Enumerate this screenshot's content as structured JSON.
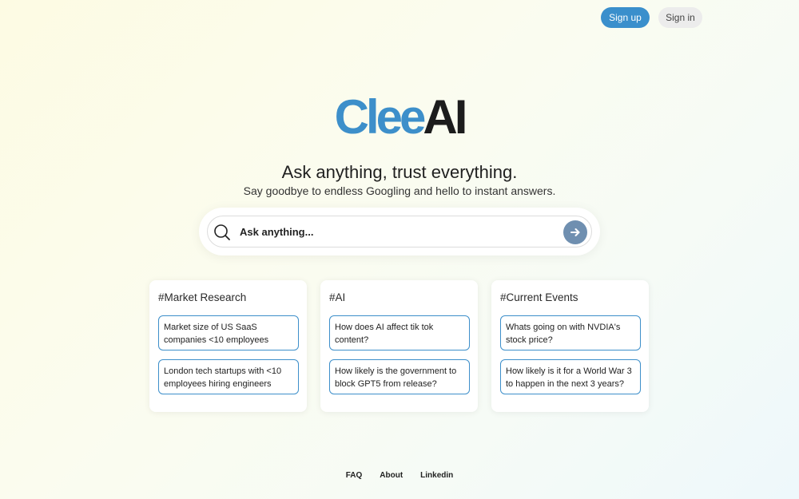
{
  "header": {
    "signup_label": "Sign up",
    "signin_label": "Sign in"
  },
  "logo": {
    "part1": "Clee",
    "part2": "AI"
  },
  "hero": {
    "headline": "Ask anything, trust everything.",
    "subline": "Say goodbye to endless Googling and hello to instant answers."
  },
  "search": {
    "placeholder": "Ask anything...",
    "value": ""
  },
  "cards": [
    {
      "title": "#Market Research",
      "questions": [
        "Market size of US SaaS companies <10 employees",
        "London tech startups with <10 employees hiring engineers"
      ]
    },
    {
      "title": "#AI",
      "questions": [
        "How does AI affect tik tok content?",
        "How likely is the government to block GPT5 from release?"
      ]
    },
    {
      "title": "#Current Events",
      "questions": [
        "Whats going on with NVDIA's stock price?",
        "How likely is it for a World War 3 to happen in the next 3 years?"
      ]
    }
  ],
  "footer": {
    "links": [
      "FAQ",
      "About",
      "Linkedin"
    ]
  },
  "colors": {
    "brand": "#3d8fca",
    "signup_bg": "#3a8fcc",
    "submit_bg": "#6f8fb0"
  }
}
